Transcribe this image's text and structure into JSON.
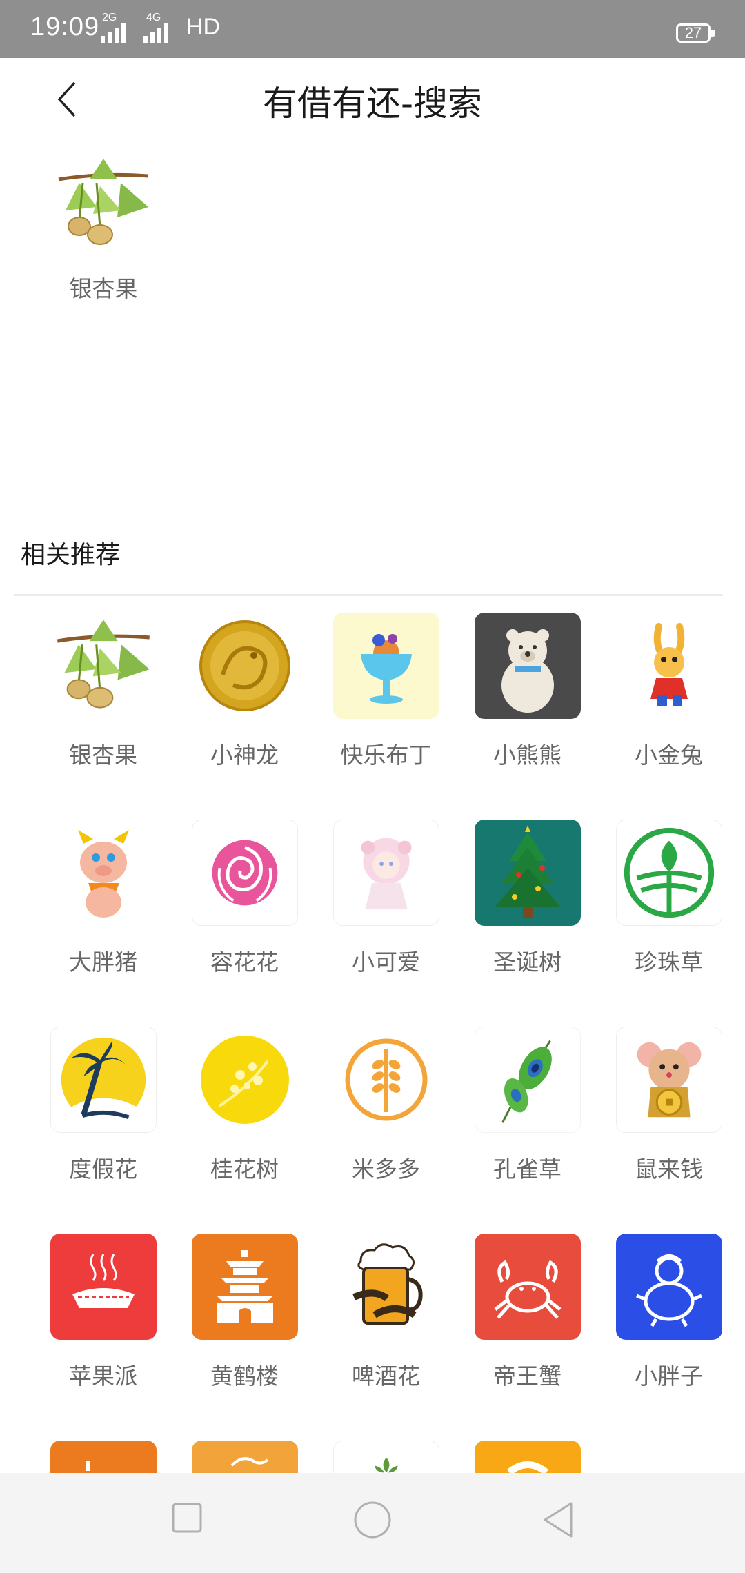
{
  "status_bar": {
    "time": "19:09",
    "sig1": "2G",
    "sig2": "4G",
    "hd": "HD",
    "battery": "27"
  },
  "header": {
    "title": "有借有还-搜索"
  },
  "search_result": {
    "label": "银杏果",
    "icon": "ginkgo-icon"
  },
  "recommend": {
    "title": "相关推荐",
    "items": [
      {
        "label": "银杏果",
        "icon": "ginkgo-icon"
      },
      {
        "label": "小神龙",
        "icon": "golden-dragon-coin-icon"
      },
      {
        "label": "快乐布丁",
        "icon": "pudding-icon"
      },
      {
        "label": "小熊熊",
        "icon": "bear-icon"
      },
      {
        "label": "小金兔",
        "icon": "rabbit-icon"
      },
      {
        "label": "大胖猪",
        "icon": "pig-icon"
      },
      {
        "label": "容花花",
        "icon": "rose-icon"
      },
      {
        "label": "小可爱",
        "icon": "anime-girl-icon"
      },
      {
        "label": "圣诞树",
        "icon": "christmas-tree-icon"
      },
      {
        "label": "珍珠草",
        "icon": "leaf-logo-icon"
      },
      {
        "label": "度假花",
        "icon": "palm-tree-icon"
      },
      {
        "label": "桂花树",
        "icon": "osmanthus-icon"
      },
      {
        "label": "米多多",
        "icon": "wheat-icon"
      },
      {
        "label": "孔雀草",
        "icon": "peacock-feather-icon"
      },
      {
        "label": "鼠来钱",
        "icon": "mouse-coin-icon"
      },
      {
        "label": "苹果派",
        "icon": "pie-icon"
      },
      {
        "label": "黄鹤楼",
        "icon": "tower-icon"
      },
      {
        "label": "啤酒花",
        "icon": "beer-icon"
      },
      {
        "label": "帝王蟹",
        "icon": "crab-icon"
      },
      {
        "label": "小胖子",
        "icon": "chubby-character-icon"
      },
      {
        "label": "",
        "icon": "orange-partial-icon"
      },
      {
        "label": "",
        "icon": "orange-swan-partial-icon"
      },
      {
        "label": "",
        "icon": "plant-partial-icon"
      },
      {
        "label": "",
        "icon": "orange-circle-partial-icon"
      }
    ]
  },
  "colors": {
    "status_bar": "#8f8f8f",
    "nav_bar": "#f4f4f4",
    "label_gray": "#666666",
    "divider": "#ebebeb"
  }
}
